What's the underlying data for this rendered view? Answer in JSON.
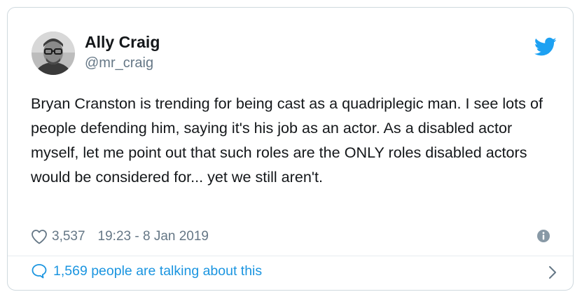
{
  "author": {
    "name": "Ally Craig",
    "handle": "@mr_craig",
    "avatar_icon": "profile-photo"
  },
  "tweet": {
    "text": "Bryan Cranston is trending for being cast as a quadriplegic man. I see lots of people defending him, saying it's his job as an actor. As a disabled actor myself, let me point out that such roles are the ONLY roles disabled actors would be considered for... yet we still aren't."
  },
  "meta": {
    "likes": "3,537",
    "timestamp": "19:23 - 8 Jan 2019",
    "like_icon": "heart-icon",
    "info_icon": "info-icon"
  },
  "footer": {
    "talking_label": "1,569 people are talking about this",
    "bubble_icon": "speech-bubble-icon",
    "chevron_icon": "chevron-right-icon"
  },
  "brand": {
    "icon": "twitter-bird-icon",
    "color": "#1da1f2",
    "link_color": "#1b95e0",
    "muted_color": "#657786",
    "border_color": "#cfd9de"
  }
}
